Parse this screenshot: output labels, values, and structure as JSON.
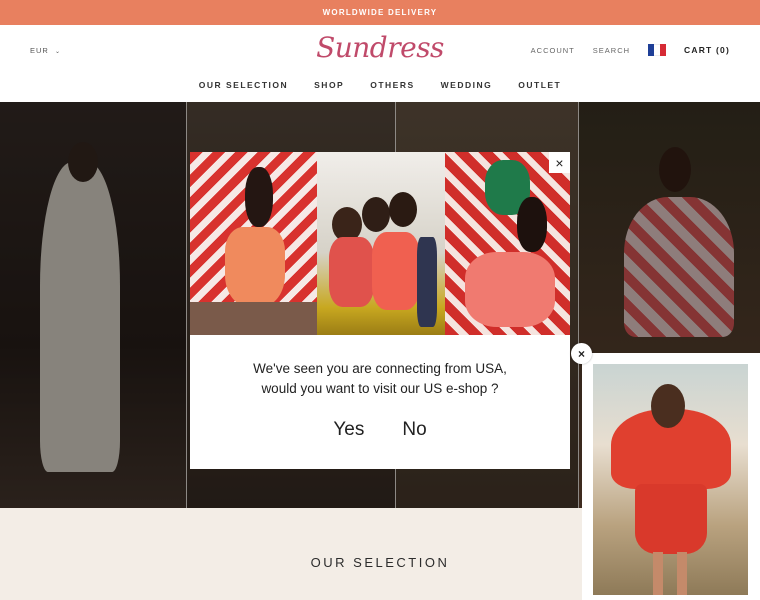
{
  "announcement": "WORLDWIDE DELIVERY",
  "header": {
    "currency": "EUR",
    "logo": "Sundress",
    "account": "ACCOUNT",
    "search": "SEARCH",
    "cart": "CART (0)"
  },
  "nav": [
    "OUR SELECTION",
    "SHOP",
    "OTHERS",
    "WEDDING",
    "OUTLET"
  ],
  "section_title": "OUR SELECTION",
  "modal": {
    "close": "×",
    "line1": "We've seen you are connecting from USA,",
    "line2": "would you want to visit our US e-shop ?",
    "yes": "Yes",
    "no": "No"
  },
  "promo": {
    "close": "×"
  },
  "colors": {
    "topbar": "#e8805f",
    "logo": "#c04a6a"
  }
}
